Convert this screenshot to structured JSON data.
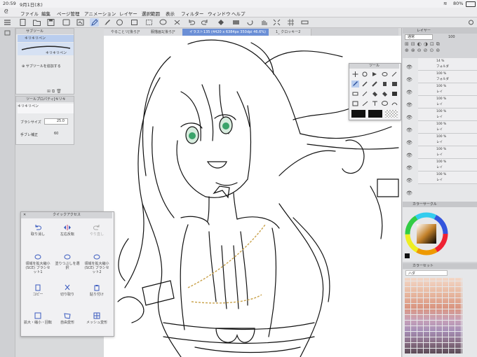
{
  "status": {
    "time": "20:59",
    "date": "9月1日(木)",
    "battery": "80%"
  },
  "menu": [
    "ファイル",
    "編集",
    "ページ管理",
    "アニメーション",
    "レイヤー",
    "選択範囲",
    "表示",
    "フィルター",
    "ウィンドウ",
    "ヘルプ"
  ],
  "tabs": [
    {
      "label": "やることリ[後ろ]*"
    },
    {
      "label": "服描画1[後ろ]*"
    },
    {
      "label": "イラスト135 (4420 x 6384px 350dpi 46.6%)"
    },
    {
      "label": "1_ クロッキー2"
    }
  ],
  "subtool": {
    "title": "サブツール",
    "items": [
      "キリキリペン",
      "キリキリペン"
    ],
    "add_label": "サブツールを追加する"
  },
  "tool_property": {
    "title": "ツールプロパティ[キリキ",
    "current": "キリキリペン",
    "brush_size_label": "ブラシサイズ",
    "brush_size_value": "25.0",
    "stabilization_label": "手ブレ補正",
    "stabilization_value": "60"
  },
  "quick_access": {
    "title": "クイックアクセス",
    "cells": [
      [
        "取り消し",
        "左右反転",
        "やり直し"
      ],
      [
        "領域を拡大縮小 (SCE) ブラシセット1",
        "塗りつぶしを選択",
        "領域を拡大縮小 (SCE) ブラシセット2"
      ],
      [
        "コピー",
        "切り取り",
        "貼り付け"
      ],
      [
        "拡大・縮小・回転",
        "自由変形",
        "メッシュ変形"
      ]
    ]
  },
  "tool_palette": {
    "title": "ツール"
  },
  "layer_panel": {
    "title": "レイヤー",
    "blend": "通常",
    "opacity": "100",
    "layers": [
      {
        "pct": "14 %",
        "name": "フォルダ"
      },
      {
        "pct": "100 %",
        "name": "フォルダ"
      },
      {
        "pct": "100 %",
        "name": "レイ"
      },
      {
        "pct": "100 %",
        "name": "レイ"
      },
      {
        "pct": "100 %",
        "name": "レイ"
      },
      {
        "pct": "100 %",
        "name": "レイ"
      },
      {
        "pct": "100 %",
        "name": "レイ"
      },
      {
        "pct": "100 %",
        "name": "レイ"
      },
      {
        "pct": "100 %",
        "name": "レイ"
      },
      {
        "pct": "100 %",
        "name": "レイ"
      },
      {
        "pct": "100 %",
        "name": "レイ"
      }
    ]
  },
  "color_circle": {
    "title": "カラーサークル"
  },
  "color_set": {
    "title": "カラーセット",
    "set_name": "ハダ"
  },
  "colors": {
    "accent": "#5b80d0",
    "eye": "#3aa36a",
    "chain": "#c9a24a"
  }
}
